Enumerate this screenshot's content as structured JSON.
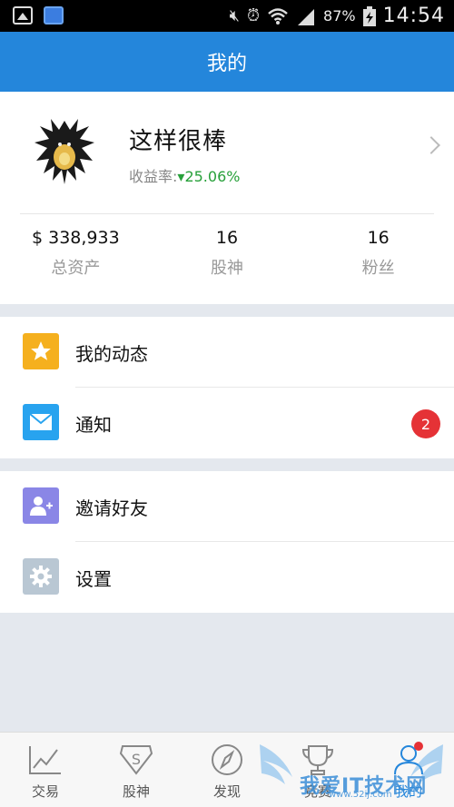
{
  "status_bar": {
    "battery_percent": "87%",
    "time": "14:54"
  },
  "header": {
    "title": "我的"
  },
  "profile": {
    "name": "这样很棒",
    "yield_label": "收益率:",
    "yield_value": "▾25.06%",
    "stats": [
      {
        "value": "$ 338,933",
        "label": "总资产"
      },
      {
        "value": "16",
        "label": "股神"
      },
      {
        "value": "16",
        "label": "粉丝"
      }
    ]
  },
  "menu_group_1": [
    {
      "label": "我的动态",
      "icon": "star-icon",
      "color": "#f5b01e"
    },
    {
      "label": "通知",
      "icon": "mail-icon",
      "color": "#28a3ef",
      "badge": "2"
    }
  ],
  "menu_group_2": [
    {
      "label": "邀请好友",
      "icon": "add-user-icon",
      "color": "#8a86e6"
    },
    {
      "label": "设置",
      "icon": "gear-icon",
      "color": "#b9c7d3"
    }
  ],
  "tabs": [
    {
      "label": "交易",
      "icon": "chart-icon"
    },
    {
      "label": "股神",
      "icon": "shield-s-icon"
    },
    {
      "label": "发现",
      "icon": "compass-icon"
    },
    {
      "label": "竞赛",
      "icon": "trophy-icon"
    },
    {
      "label": "我的",
      "icon": "person-icon",
      "active": true
    }
  ],
  "watermark": {
    "text": "我爱IT技术网",
    "sub": "www.52ij.com"
  },
  "colors": {
    "primary": "#2486db",
    "badge": "#e53236",
    "positive": "#27a03a"
  }
}
